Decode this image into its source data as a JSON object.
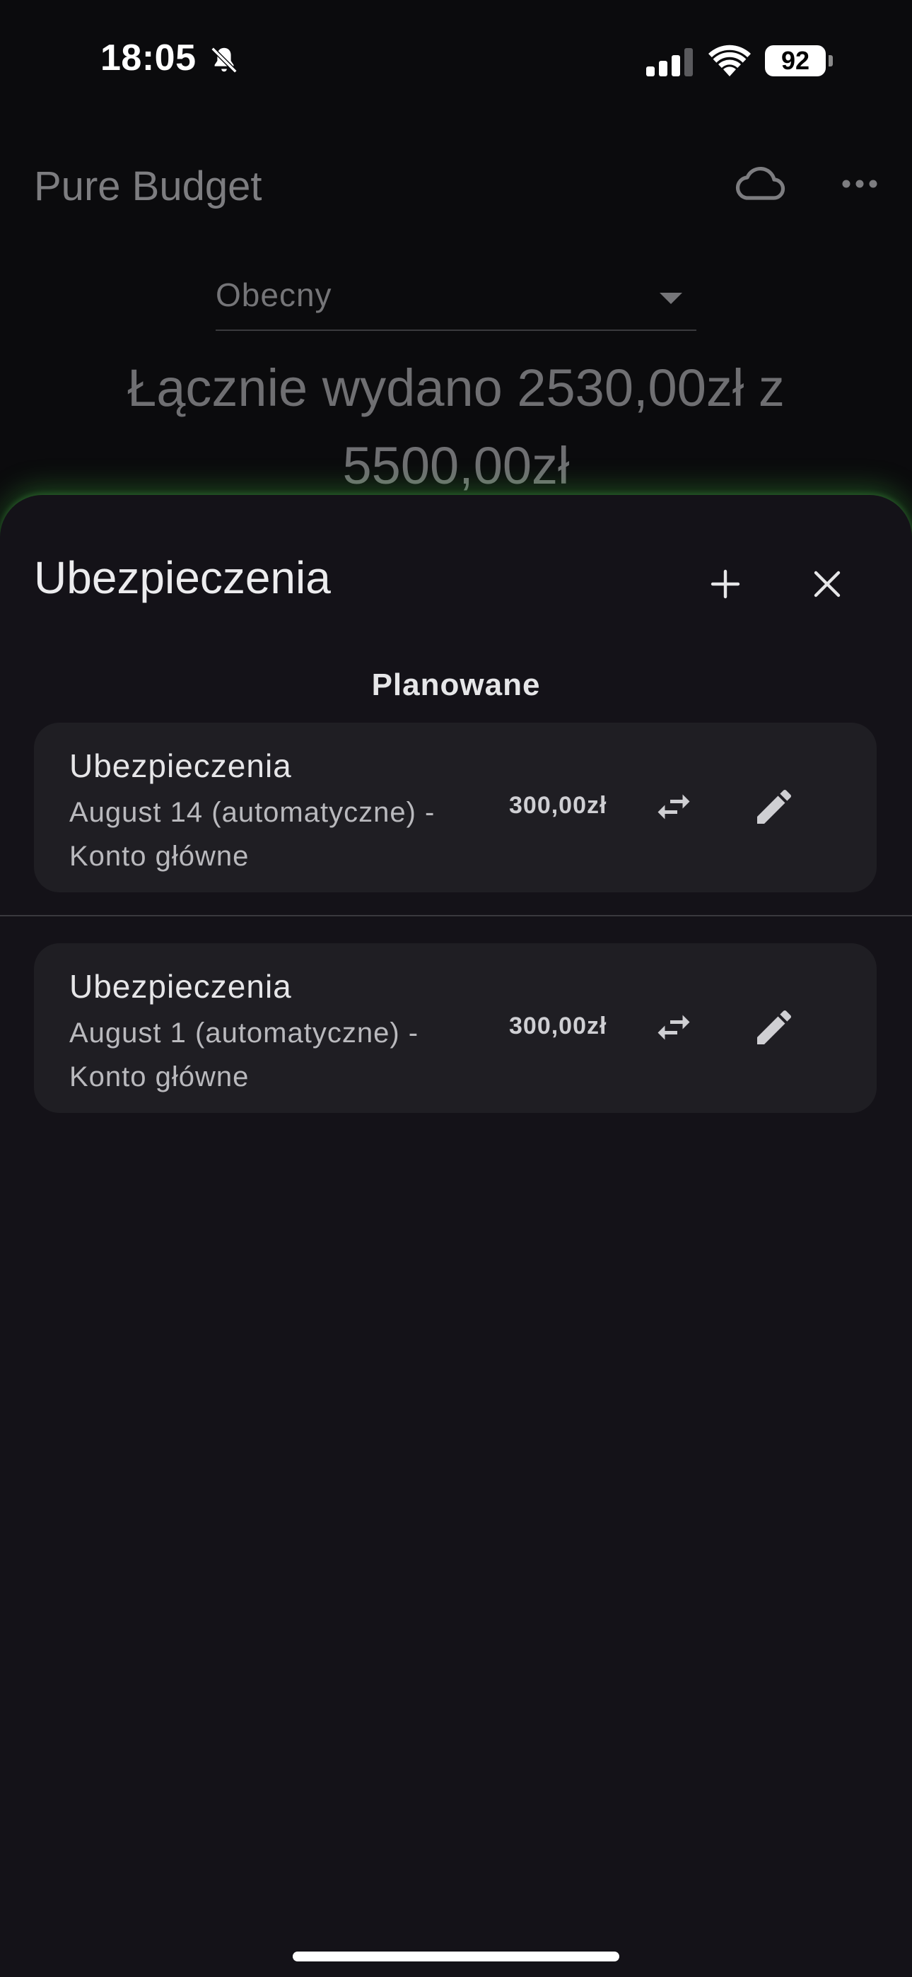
{
  "status_bar": {
    "time": "18:05",
    "battery": "92",
    "icons": [
      "bell-slash-icon",
      "cellular-signal-icon",
      "wifi-icon",
      "battery-icon"
    ]
  },
  "header": {
    "title": "Pure Budget",
    "icons": [
      "cloud-icon",
      "more-horizontal-icon"
    ]
  },
  "period": {
    "selected": "Obecny"
  },
  "summary": {
    "text": "Łącznie wydano 2530,00zł z 5500,00zł"
  },
  "sheet": {
    "title": "Ubezpieczenia",
    "icons": [
      "plus-icon",
      "close-icon"
    ],
    "section_title": "Planowane",
    "transactions": [
      {
        "name": "Ubezpieczenia",
        "detail": "August 14 (automatyczne) - Konto główne",
        "amount": "300,00zł"
      },
      {
        "name": "Ubezpieczenia",
        "detail": "August 1 (automatyczne) - Konto główne",
        "amount": "300,00zł"
      }
    ]
  },
  "colors": {
    "background": "#0b0b0d",
    "sheet": "#141218",
    "card": "#1f1e23",
    "glow": "#46c846"
  }
}
